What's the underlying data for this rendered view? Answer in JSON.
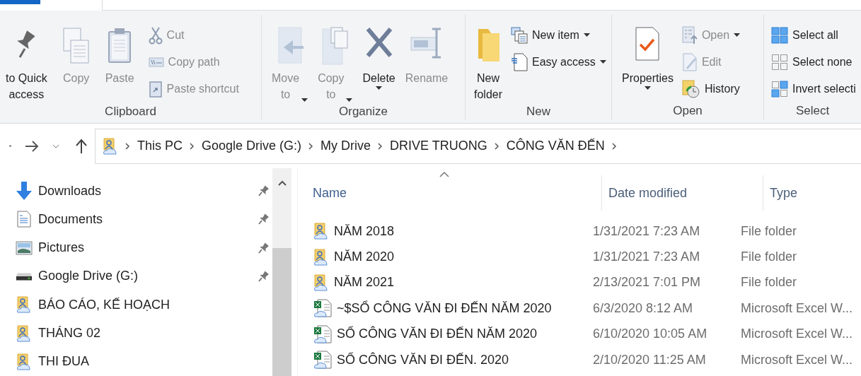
{
  "ribbon": {
    "groups": [
      {
        "label": "Clipboard",
        "items": [
          {
            "kind": "large",
            "label": "to Quick\naccess",
            "disabled": false,
            "dropdown": false
          },
          {
            "kind": "large",
            "label": "Copy",
            "disabled": true,
            "dropdown": false
          },
          {
            "kind": "large",
            "label": "Paste",
            "disabled": true,
            "dropdown": false
          },
          {
            "kind": "stack",
            "buttons": [
              {
                "label": "Cut",
                "disabled": true,
                "dropdown": false
              },
              {
                "label": "Copy path",
                "disabled": true,
                "dropdown": false
              },
              {
                "label": "Paste shortcut",
                "disabled": true,
                "dropdown": false
              }
            ]
          }
        ]
      },
      {
        "label": "Organize",
        "items": [
          {
            "kind": "large",
            "label": "Move\nto",
            "disabled": true,
            "dropdown": true
          },
          {
            "kind": "large",
            "label": "Copy\nto",
            "disabled": true,
            "dropdown": true
          },
          {
            "kind": "large",
            "label": "Delete",
            "disabled": false,
            "dropdown": true
          },
          {
            "kind": "large",
            "label": "Rename",
            "disabled": true,
            "dropdown": false
          }
        ]
      },
      {
        "label": "New",
        "items": [
          {
            "kind": "large",
            "label": "New\nfolder",
            "disabled": false,
            "dropdown": false
          },
          {
            "kind": "stack",
            "buttons": [
              {
                "label": "New item",
                "disabled": false,
                "dropdown": true
              },
              {
                "label": "Easy access",
                "disabled": false,
                "dropdown": true
              }
            ]
          }
        ]
      },
      {
        "label": "Open",
        "items": [
          {
            "kind": "large",
            "label": "Properties",
            "disabled": false,
            "dropdown": true
          },
          {
            "kind": "stack",
            "buttons": [
              {
                "label": "Open",
                "disabled": true,
                "dropdown": true
              },
              {
                "label": "Edit",
                "disabled": true,
                "dropdown": false
              },
              {
                "label": "History",
                "disabled": false,
                "dropdown": false
              }
            ]
          }
        ]
      },
      {
        "label": "Select",
        "items": [
          {
            "kind": "stack",
            "buttons": [
              {
                "label": "Select all",
                "disabled": false,
                "dropdown": false
              },
              {
                "label": "Select none",
                "disabled": false,
                "dropdown": false
              },
              {
                "label": "Invert selecti",
                "disabled": false,
                "dropdown": false
              }
            ]
          }
        ]
      }
    ]
  },
  "address_bar": {
    "crumbs": [
      "This PC",
      "Google Drive (G:)",
      "My Drive",
      "DRIVE TRUONG",
      "CÔNG VĂN ĐẾN"
    ]
  },
  "navigation": {
    "items": [
      {
        "kind": "downloads",
        "label": "Downloads",
        "pinned": true
      },
      {
        "kind": "documents",
        "label": "Documents",
        "pinned": true
      },
      {
        "kind": "pictures",
        "label": "Pictures",
        "pinned": true
      },
      {
        "kind": "drive",
        "label": "Google Drive (G:)",
        "pinned": true
      },
      {
        "kind": "folder",
        "label": "BÁO CÁO, KẾ HOẠCH",
        "pinned": false
      },
      {
        "kind": "folder",
        "label": "THÁNG 02",
        "pinned": false
      },
      {
        "kind": "folder",
        "label": "THI ĐUA",
        "pinned": false
      }
    ]
  },
  "file_list": {
    "columns": [
      "Name",
      "Date modified",
      "Type"
    ],
    "rows": [
      {
        "kind": "folder",
        "name": "NĂM 2018",
        "date": "1/31/2021 7:23 AM",
        "type": "File folder"
      },
      {
        "kind": "folder",
        "name": "NĂM 2020",
        "date": "1/31/2021 7:23 AM",
        "type": "File folder"
      },
      {
        "kind": "folder",
        "name": "NĂM 2021",
        "date": "2/13/2021 7:01 PM",
        "type": "File folder"
      },
      {
        "kind": "excel",
        "name": "~$SỔ CÔNG VĂN ĐI ĐẾN NĂM 2020",
        "date": "6/3/2020 8:12 AM",
        "type": "Microsoft Excel W..."
      },
      {
        "kind": "excel",
        "name": "SỔ CÔNG VĂN ĐI ĐẾN NĂM 2020",
        "date": "6/10/2020 10:05 AM",
        "type": "Microsoft Excel W..."
      },
      {
        "kind": "excel",
        "name": "SỔ CÔNG VĂN ĐI ĐẾN. 2020",
        "date": "2/10/2020 11:25 AM",
        "type": "Microsoft Excel W..."
      }
    ]
  }
}
